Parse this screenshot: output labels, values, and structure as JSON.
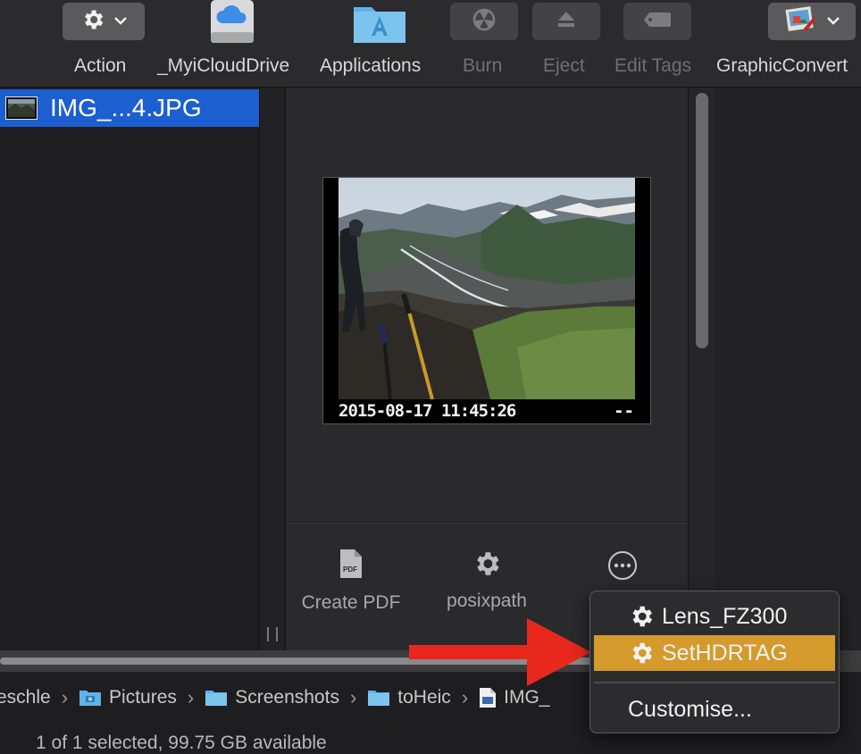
{
  "toolbar": {
    "action_label": "Action",
    "icloud_label": "_MyiCloudDrive",
    "applications_label": "Applications",
    "burn_label": "Burn",
    "eject_label": "Eject",
    "edit_tags_label": "Edit Tags",
    "graphicconverter_label": "GraphicConvert"
  },
  "file_list": {
    "selected_file": "IMG_...4.JPG"
  },
  "preview": {
    "timestamp": "2015-08-17 11:45:26",
    "right_text": "--"
  },
  "quick_actions": [
    {
      "label": "Create PDF"
    },
    {
      "label": "posixpath"
    }
  ],
  "context_menu": {
    "items": [
      {
        "label": "Lens_FZ300"
      },
      {
        "label": "SetHDRTAG"
      }
    ],
    "customise_label": "Customise..."
  },
  "path_bar": {
    "crumbs": [
      "eschle",
      "Pictures",
      "Screenshots",
      "toHeic",
      "IMG_"
    ]
  },
  "status": {
    "text": "1 of 1 selected, 99.75 GB available"
  },
  "colors": {
    "selection": "#1b5fd0",
    "menu_highlight": "#d49a2c",
    "arrow": "#e8281c",
    "folder": "#5fb3e6"
  }
}
